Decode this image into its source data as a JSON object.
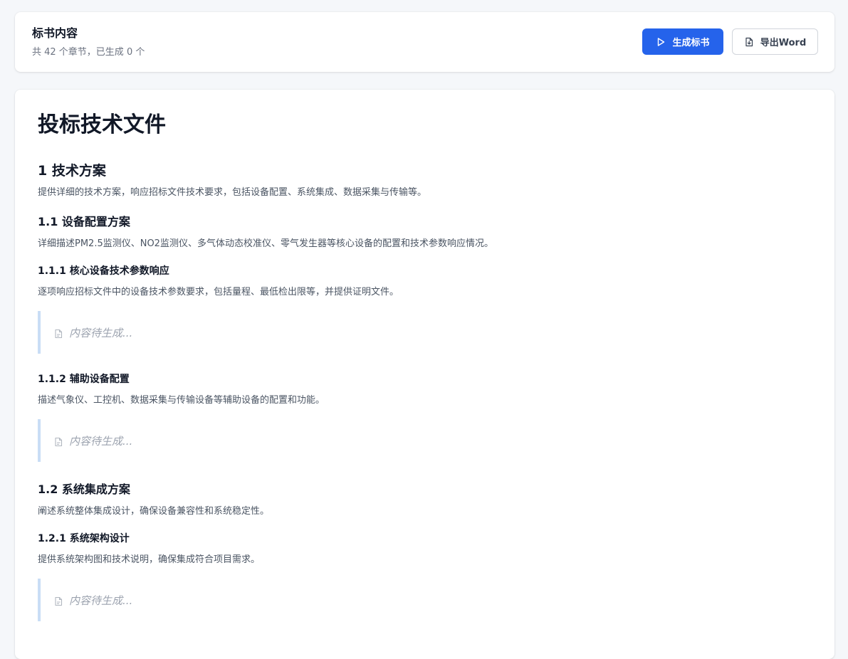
{
  "header": {
    "title": "标书内容",
    "subtitle": "共 42 个章节，已生成 0 个",
    "generate_button": "生成标书",
    "export_button": "导出Word"
  },
  "document": {
    "title": "投标技术文件",
    "sections": [
      {
        "heading": "1 技术方案",
        "description": "提供详细的技术方案，响应招标文件技术要求，包括设备配置、系统集成、数据采集与传输等。"
      },
      {
        "heading": "1.1 设备配置方案",
        "description": "详细描述PM2.5监测仪、NO2监测仪、多气体动态校准仪、零气发生器等核心设备的配置和技术参数响应情况。"
      },
      {
        "heading": "1.1.1 核心设备技术参数响应",
        "description": "逐项响应招标文件中的设备技术参数要求，包括量程、最低检出限等，并提供证明文件。",
        "placeholder": "内容待生成..."
      },
      {
        "heading": "1.1.2 辅助设备配置",
        "description": "描述气象仪、工控机、数据采集与传输设备等辅助设备的配置和功能。",
        "placeholder": "内容待生成..."
      },
      {
        "heading": "1.2 系统集成方案",
        "description": "阐述系统整体集成设计，确保设备兼容性和系统稳定性。"
      },
      {
        "heading": "1.2.1 系统架构设计",
        "description": "提供系统架构图和技术说明，确保集成符合项目需求。",
        "placeholder": "内容待生成..."
      }
    ]
  },
  "colors": {
    "primary": "#2563eb",
    "placeholder_border": "#c9ddf5",
    "muted_text": "#9ca3af"
  },
  "icons": {
    "generate": "play-icon",
    "export": "file-download-icon",
    "placeholder": "file-text-icon"
  }
}
